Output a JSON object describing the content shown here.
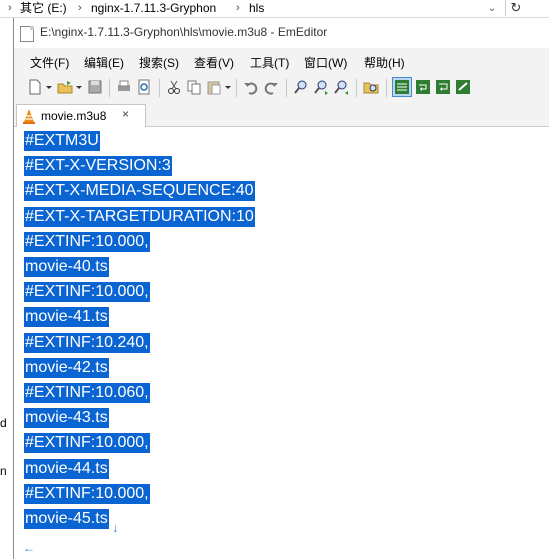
{
  "explorer": {
    "crumbs": [
      "其它 (E:)",
      "nginx-1.7.11.3-Gryphon",
      "hls"
    ],
    "left_chars": [
      "d",
      "n"
    ]
  },
  "window": {
    "title": "E:\\nginx-1.7.11.3-Gryphon\\hls\\movie.m3u8 - EmEditor"
  },
  "menu": [
    "文件(F)",
    "编辑(E)",
    "搜索(S)",
    "查看(V)",
    "工具(T)",
    "窗口(W)",
    "帮助(H)"
  ],
  "toolbar_icons": [
    "new-file-icon",
    "open-folder-icon",
    "save-icon",
    "print-icon",
    "print-preview-icon",
    "cut-icon",
    "copy-icon",
    "paste-icon",
    "undo-icon",
    "redo-icon",
    "find-icon",
    "find-next-icon",
    "find-prev-icon",
    "find-in-files-icon",
    "word-wrap-icon",
    "window-wrap-icon",
    "page-wrap-icon",
    "macro-icon"
  ],
  "tab": {
    "title": "movie.m3u8",
    "close": "×"
  },
  "lines": [
    "#EXTM3U",
    "#EXT-X-VERSION:3",
    "#EXT-X-MEDIA-SEQUENCE:40",
    "#EXT-X-TARGETDURATION:10",
    "#EXTINF:10.000,",
    "movie-40.ts",
    "#EXTINF:10.000,",
    "movie-41.ts",
    "#EXTINF:10.240,",
    "movie-42.ts",
    "#EXTINF:10.060,",
    "movie-43.ts",
    "#EXTINF:10.000,",
    "movie-44.ts",
    "#EXTINF:10.000,",
    "movie-45.ts"
  ],
  "markers": {
    "eol": "↓",
    "eof": "←"
  },
  "colors": {
    "selection": "#0a64d2",
    "marker": "#3a86e0"
  }
}
